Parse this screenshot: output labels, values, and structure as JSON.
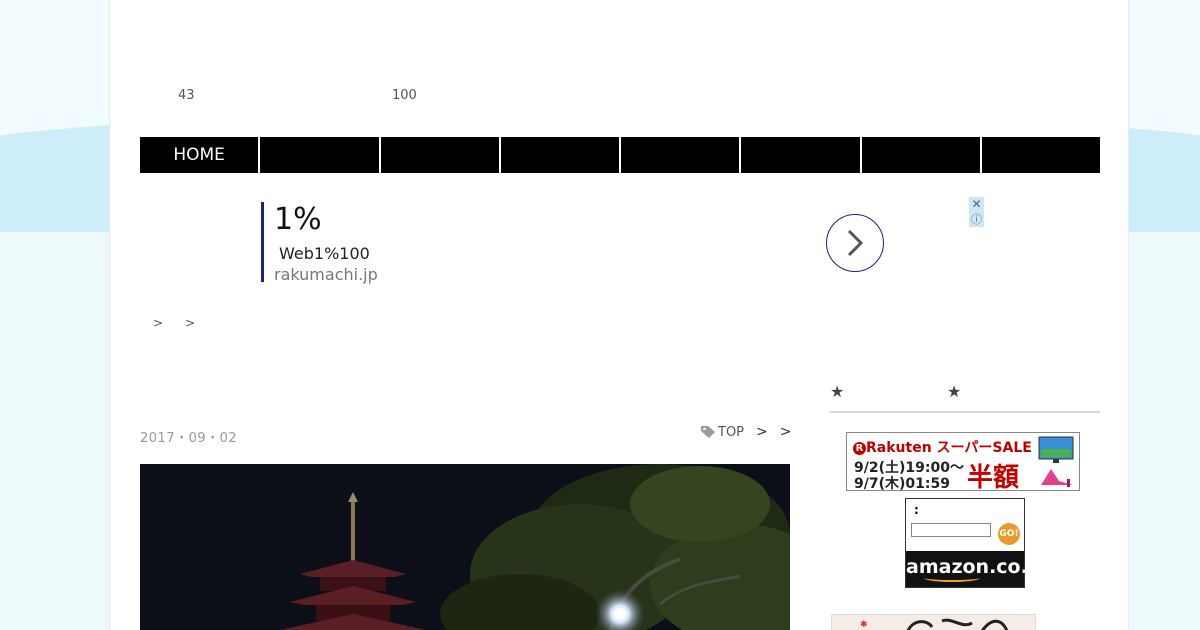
{
  "header": {
    "count_left": "43",
    "count_right": "100"
  },
  "nav": {
    "items": [
      "HOME",
      "",
      "",
      "",
      "",
      "",
      "",
      ""
    ]
  },
  "ad": {
    "title": "1%",
    "subtitle": "Web1%100",
    "url": "rakumachi.jp",
    "close_glyph": "✕",
    "info_glyph": "ⓘ"
  },
  "breadcrumb": {
    "separators": [
      ">",
      ">"
    ]
  },
  "sidebar": {
    "heading_star_left": "★",
    "heading_star_right": "★"
  },
  "post": {
    "date": "2017・09・02",
    "tag_label": "TOP",
    "tag_separators": [
      ">",
      ">"
    ]
  },
  "rakuten_banner": {
    "brand": "Rakuten",
    "sale": "スーパーSALE",
    "date_line_1": "9/2(土)19:00～",
    "date_line_2": "9/7(木)01:59",
    "half_price": "半額"
  },
  "amazon_widget": {
    "label": ":",
    "go_label": "GO!",
    "logo_text": "amazon.co.jp"
  },
  "colors": {
    "nav_bg": "#000000",
    "ad_accent": "#1a237e",
    "rakuten_red": "#bf0000",
    "background_wave": "#cdeef9"
  }
}
